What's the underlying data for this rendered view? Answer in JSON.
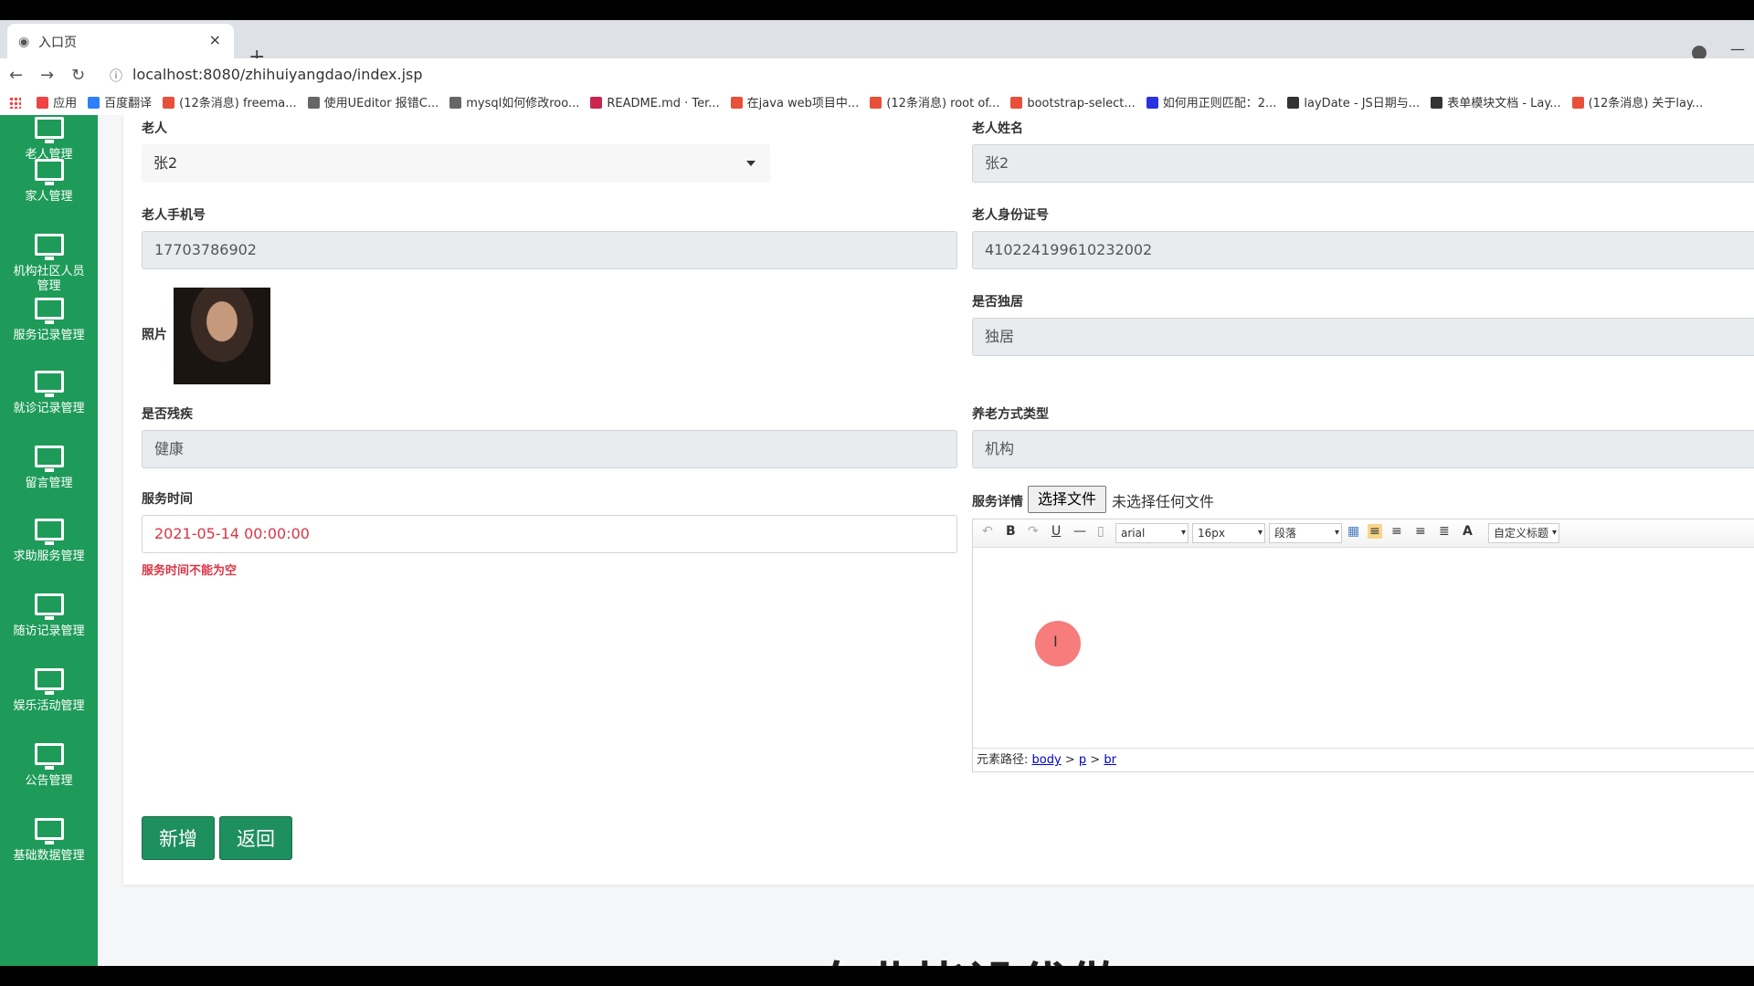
{
  "browser": {
    "tab_title": "入口页",
    "tab_close": "×",
    "new_tab": "+",
    "url": "localhost:8080/zhihuiyangdao/index.jsp",
    "nav_back": "←",
    "nav_forward": "→",
    "nav_reload": "↻",
    "info_icon": "ⓘ",
    "bookmarks": [
      {
        "label": "应用",
        "color": "#e44"
      },
      {
        "label": "百度翻译",
        "color": "#2d7ff9"
      },
      {
        "label": "(12条消息) freema...",
        "color": "#e8503a"
      },
      {
        "label": "使用UEditor 报错C...",
        "color": "#666"
      },
      {
        "label": "mysql如何修改roo...",
        "color": "#666"
      },
      {
        "label": "README.md · Ter...",
        "color": "#c7254e"
      },
      {
        "label": "在java web项目中...",
        "color": "#e8503a"
      },
      {
        "label": "(12条消息) root of...",
        "color": "#e8503a"
      },
      {
        "label": "bootstrap-select...",
        "color": "#e8503a"
      },
      {
        "label": "如何用正则匹配：2...",
        "color": "#2932e1"
      },
      {
        "label": "layDate - JS日期与...",
        "color": "#333"
      },
      {
        "label": "表单模块文档 - Lay...",
        "color": "#333"
      },
      {
        "label": "(12条消息) 关于lay...",
        "color": "#e8503a"
      }
    ]
  },
  "sidebar": {
    "items": [
      {
        "label": "老人管理"
      },
      {
        "label": "家人管理"
      },
      {
        "label": "机构社区人员管理"
      },
      {
        "label": "服务记录管理"
      },
      {
        "label": "就诊记录管理"
      },
      {
        "label": "留言管理"
      },
      {
        "label": "求助服务管理"
      },
      {
        "label": "随访记录管理"
      },
      {
        "label": "娱乐活动管理"
      },
      {
        "label": "公告管理"
      },
      {
        "label": "基础数据管理"
      }
    ]
  },
  "form": {
    "elder_label": "老人",
    "elder_value": "张2",
    "elder_name_label": "老人姓名",
    "elder_name_value": "张2",
    "phone_label": "老人手机号",
    "phone_value": "17703786902",
    "id_label": "老人身份证号",
    "id_value": "410224199610232002",
    "photo_label": "照片",
    "alone_label": "是否独居",
    "alone_value": "独居",
    "disabled_label": "是否残疾",
    "disabled_value": "健康",
    "care_type_label": "养老方式类型",
    "care_type_value": "机构",
    "service_time_label": "服务时间",
    "service_time_value": "2021-05-14 00:00:00",
    "service_time_error": "服务时间不能为空",
    "detail_label": "服务详情",
    "file_button": "选择文件",
    "file_status": "未选择任何文件",
    "editor": {
      "font": "arial",
      "size": "16px",
      "paragraph": "段落",
      "custom_title": "自定义标题",
      "path_label": "元素路径:",
      "path_body": "body",
      "path_p": "p",
      "path_br": "br",
      "sep": ">"
    },
    "add_button": "新增",
    "back_button": "返回"
  },
  "footer_text": "专业毕设代做"
}
